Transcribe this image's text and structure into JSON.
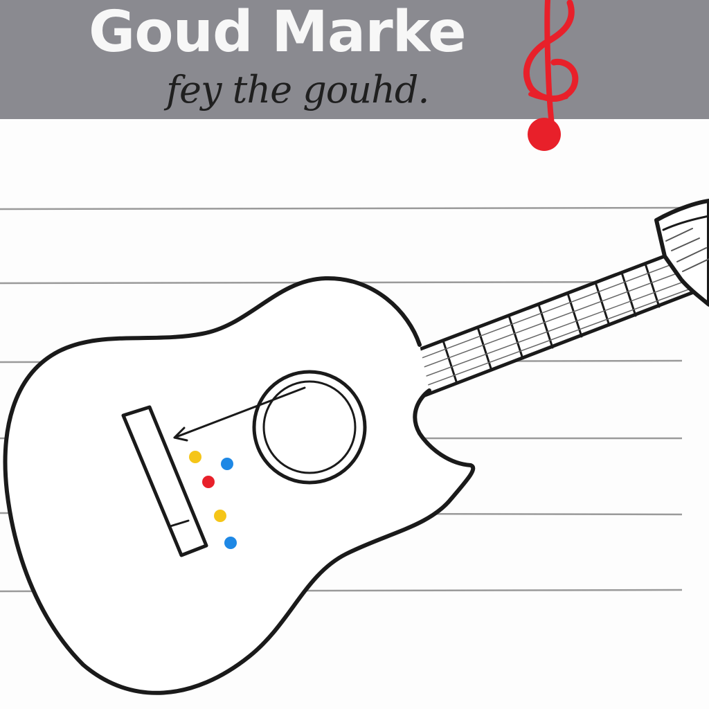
{
  "header": {
    "title": "Goud Marke",
    "subtitle": "fey the gouhd."
  },
  "icons": {
    "clef": "treble-clef-icon",
    "guitar": "acoustic-guitar-icon"
  },
  "colors": {
    "header_band": "#8a8a90",
    "title_text": "#f7f7f7",
    "subtitle_text": "#1f1f1f",
    "clef": "#e8202a",
    "outline": "#1a1a1a",
    "staff_line": "#9a9a9a",
    "dot_red": "#e8202a",
    "dot_blue": "#1e88e5",
    "dot_yellow": "#f5c518"
  }
}
